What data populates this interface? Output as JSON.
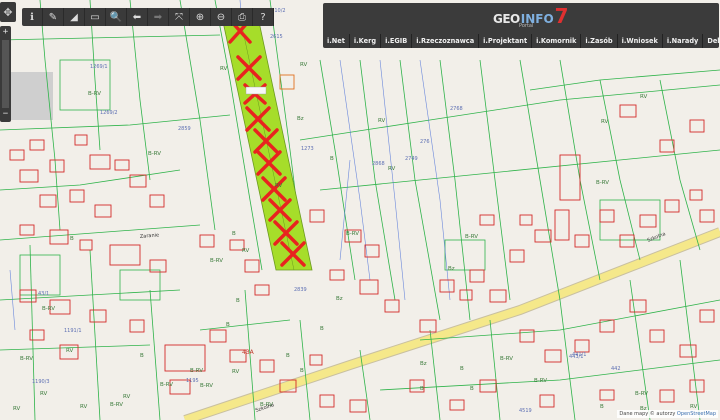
{
  "toolbar": {
    "buttons": [
      {
        "name": "info-icon",
        "glyph": "ℹ"
      },
      {
        "name": "pencil-icon",
        "glyph": "✎"
      },
      {
        "name": "measure-area-icon",
        "glyph": "◢"
      },
      {
        "name": "measure-distance-icon",
        "glyph": "▭"
      },
      {
        "name": "zoom-search-icon",
        "glyph": "🔍"
      },
      {
        "name": "back-icon",
        "glyph": "⬅"
      },
      {
        "name": "forward-icon",
        "glyph": "➡"
      },
      {
        "name": "fullscreen-icon",
        "glyph": "⤧"
      },
      {
        "name": "zoom-in-icon",
        "glyph": "⊕"
      },
      {
        "name": "zoom-out-icon",
        "glyph": "⊖"
      },
      {
        "name": "print-icon",
        "glyph": "⎙"
      },
      {
        "name": "help-icon",
        "glyph": "?"
      }
    ]
  },
  "nav": {
    "pan": "✥",
    "zoom_in": "+",
    "zoom_out": "−"
  },
  "brand": {
    "geo": "GEO",
    "info": "INFO",
    "number": "7",
    "sub": "Portal"
  },
  "menu": [
    "i.Net",
    "i.Kerg",
    "i.EGIB",
    "i.Rzeczoznawca",
    "i.Projektant",
    "i.Komornik",
    "i.Zasób",
    "i.Wniosek",
    "i.Narady",
    "Delta"
  ],
  "attribution": {
    "text": "Dane mapy © autorzy",
    "link": "OpenStreetMap"
  },
  "map": {
    "colors": {
      "background": "#f2efe9",
      "parcel": "#2fb34a",
      "building": "#d42a2a",
      "highlight": "#a6dd2a",
      "cross": "#e8231f",
      "road": "#f5e88a",
      "use_line": "#4a6fd8"
    },
    "parcel_labels": [
      {
        "t": "2810/2",
        "c": "lbl-blue"
      },
      {
        "t": "1269/1",
        "c": "lbl-blue"
      },
      {
        "t": "1269/2",
        "c": "lbl-blue"
      },
      {
        "t": "B-RV",
        "c": "lbl"
      },
      {
        "t": "RV",
        "c": "lbl"
      },
      {
        "t": "2859",
        "c": "lbl-blue"
      },
      {
        "t": "B-RV",
        "c": "lbl"
      },
      {
        "t": "2615",
        "c": "lbl-blue"
      },
      {
        "t": "RV",
        "c": "lbl"
      },
      {
        "t": "Bz",
        "c": "lbl"
      },
      {
        "t": "RV",
        "c": "lbl"
      },
      {
        "t": "1273",
        "c": "lbl-blue"
      },
      {
        "t": "B",
        "c": "lbl"
      },
      {
        "t": "2868",
        "c": "lbl-blue"
      },
      {
        "t": "RV",
        "c": "lbl"
      },
      {
        "t": "2768",
        "c": "lbl-blue"
      },
      {
        "t": "276",
        "c": "lbl-blue"
      },
      {
        "t": "2749",
        "c": "lbl-blue"
      },
      {
        "t": "RV",
        "c": "lbl"
      },
      {
        "t": "B-RV",
        "c": "lbl"
      },
      {
        "t": "Bz",
        "c": "lbl"
      },
      {
        "t": "B-RV",
        "c": "lbl"
      },
      {
        "t": "B-RV",
        "c": "lbl"
      },
      {
        "t": "RV",
        "c": "lbl"
      },
      {
        "t": "RV",
        "c": "lbl"
      },
      {
        "t": "2839",
        "c": "lbl-blue"
      },
      {
        "t": "Bz",
        "c": "lbl"
      },
      {
        "t": "B",
        "c": "lbl"
      },
      {
        "t": "RV",
        "c": "lbl"
      },
      {
        "t": "B-RV",
        "c": "lbl"
      },
      {
        "t": "B",
        "c": "lbl"
      },
      {
        "t": "B",
        "c": "lbl"
      },
      {
        "t": "B",
        "c": "lbl"
      },
      {
        "t": "B",
        "c": "lbl"
      },
      {
        "t": "B-RV",
        "c": "lbl"
      },
      {
        "t": "RV",
        "c": "lbl"
      },
      {
        "t": "1191/1",
        "c": "lbl-blue"
      },
      {
        "t": "RV",
        "c": "lbl"
      },
      {
        "t": "1190/3",
        "c": "lbl-blue"
      },
      {
        "t": "B-RV",
        "c": "lbl"
      },
      {
        "t": "B",
        "c": "lbl"
      },
      {
        "t": "1195",
        "c": "lbl-blue"
      },
      {
        "t": "B-RV",
        "c": "lbl"
      },
      {
        "t": "43/1",
        "c": "lbl-blue"
      },
      {
        "t": "RV",
        "c": "lbl"
      },
      {
        "t": "B",
        "c": "lbl"
      },
      {
        "t": "B",
        "c": "lbl"
      },
      {
        "t": "Bz",
        "c": "lbl"
      },
      {
        "t": "B",
        "c": "lbl"
      },
      {
        "t": "B-RV",
        "c": "lbl"
      },
      {
        "t": "B",
        "c": "lbl"
      },
      {
        "t": "B-RV",
        "c": "lbl"
      },
      {
        "t": "441/1",
        "c": "lbl-blue"
      },
      {
        "t": "442",
        "c": "lbl-blue"
      },
      {
        "t": "443/1",
        "c": "lbl-blue"
      },
      {
        "t": "4519",
        "c": "lbl-blue"
      },
      {
        "t": "RV",
        "c": "lbl"
      },
      {
        "t": "B",
        "c": "lbl"
      },
      {
        "t": "43A",
        "c": "lbl-red"
      },
      {
        "t": "RV",
        "c": "lbl"
      },
      {
        "t": "B-RV",
        "c": "lbl"
      },
      {
        "t": "RV",
        "c": "lbl"
      },
      {
        "t": "B-RV",
        "c": "lbl"
      },
      {
        "t": "B-RV",
        "c": "lbl"
      },
      {
        "t": "B-RV",
        "c": "lbl"
      },
      {
        "t": "B",
        "c": "lbl"
      },
      {
        "t": "B-RV",
        "c": "lbl"
      },
      {
        "t": "RV",
        "c": "lbl"
      },
      {
        "t": "Bz",
        "c": "lbl"
      }
    ],
    "street_labels": [
      {
        "t": "Zaranie"
      },
      {
        "t": "Szkolna"
      },
      {
        "t": "Szkolna"
      }
    ]
  }
}
